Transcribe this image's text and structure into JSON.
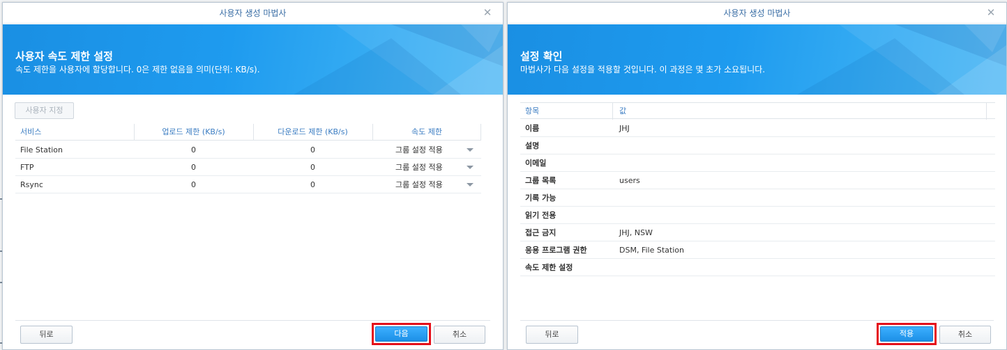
{
  "left_dialog": {
    "title": "사용자 생성 마법사",
    "header_title": "사용자 속도 제한 설정",
    "header_subtitle": "속도 제한을 사용자에 할당합니다. 0은 제한 없음을 의미(단위: KB/s).",
    "custom_button": "사용자 지정",
    "columns": [
      "서비스",
      "업로드 제한 (KB/s)",
      "다운로드 제한 (KB/s)",
      "속도 제한"
    ],
    "rows": [
      {
        "service": "File Station",
        "upload": "0",
        "download": "0",
        "limit": "그룹 설정 적용"
      },
      {
        "service": "FTP",
        "upload": "0",
        "download": "0",
        "limit": "그룹 설정 적용"
      },
      {
        "service": "Rsync",
        "upload": "0",
        "download": "0",
        "limit": "그룹 설정 적용"
      }
    ],
    "back_button": "뒤로",
    "next_button": "다음",
    "cancel_button": "취소"
  },
  "right_dialog": {
    "title": "사용자 생성 마법사",
    "header_title": "설정 확인",
    "header_subtitle": "마법사가 다음 설정을 적용할 것입니다. 이 과정은 몇 초가 소요됩니다.",
    "columns": [
      "항목",
      "값"
    ],
    "rows": [
      {
        "item": "이름",
        "value": "JHJ"
      },
      {
        "item": "설명",
        "value": ""
      },
      {
        "item": "이메일",
        "value": ""
      },
      {
        "item": "그룹 목록",
        "value": "users"
      },
      {
        "item": "기록 가능",
        "value": ""
      },
      {
        "item": "읽기 전용",
        "value": ""
      },
      {
        "item": "접근 금지",
        "value": "JHJ, NSW"
      },
      {
        "item": "응용 프로그램 권한",
        "value": "DSM, File Station"
      },
      {
        "item": "속도 제한 설정",
        "value": ""
      }
    ],
    "back_button": "뒤로",
    "apply_button": "적용",
    "cancel_button": "취소"
  },
  "colors": {
    "accent": "#1e9bef",
    "header_text": "#3a7cc2",
    "highlight": "#e5101a"
  },
  "icons": [
    "close-icon",
    "chevron-down-icon"
  ]
}
